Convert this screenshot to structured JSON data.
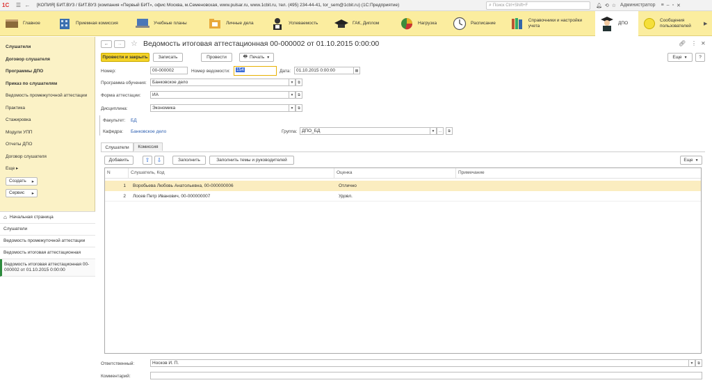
{
  "titlebar": {
    "logo": "1С",
    "title": "[КОПИЯ] БИТ.ВУЗ / БИТ.ВУЗ (компания «Первый БИТ», офис Москва, м.Семеновская, www.pulsar.ru, www.1cbit.ru, тел. (495) 234-44-41, tor_sem@1cbit.ru) (1С:Предприятие)",
    "search_placeholder": "Поиск Ctrl+Shift+F",
    "user": "Администратор"
  },
  "sections": [
    {
      "label": "Главное"
    },
    {
      "label": "Приемная комиссия"
    },
    {
      "label": "Учебные планы"
    },
    {
      "label": "Личные дела"
    },
    {
      "label": "Успеваемость"
    },
    {
      "label": "ГАК, Диплом"
    },
    {
      "label": "Нагрузка"
    },
    {
      "label": "Расписание"
    },
    {
      "label": "Справочники и настройки учета"
    },
    {
      "label": "ДПО"
    },
    {
      "label": "Сообщения пользователей"
    }
  ],
  "nav": {
    "items": [
      "Слушатели",
      "Договор слушателя",
      "Программы ДПО",
      "Приказ по слушателям",
      "Ведомость промежуточной аттестации",
      "Практика",
      "Стажировка",
      "Модули УПП",
      "Отчеты ДПО",
      "Договор слушателя",
      "Еще"
    ],
    "create": "Создать",
    "service": "Сервис"
  },
  "history": {
    "home": "Начальная страница",
    "items": [
      "Слушатели",
      "Ведомость промежуточной аттестации",
      "Ведомость итоговая аттестационная",
      "Ведомость итоговая аттестационная 00-000002 от 01.10.2015 0:00:00"
    ]
  },
  "form": {
    "title": "Ведомость итоговая аттестационная 00-000002 от 01.10.2015 0:00:00",
    "buttons": {
      "post_close": "Провести и закрыть",
      "save": "Записать",
      "post": "Провести",
      "print": "Печать",
      "more": "Еще",
      "help": "?"
    },
    "number_label": "Номер:",
    "number": "00-000002",
    "sheet_label": "Номер ведомости:",
    "sheet": "154",
    "date_label": "Дата:",
    "date": "01.10.2015  0:00:00",
    "program_label": "Программа обучения:",
    "program": "Банковское дело",
    "form_label": "Форма аттестации:",
    "form_value": "ИА",
    "discipline_label": "Дисциплина:",
    "discipline": "Экономика",
    "faculty_label": "Факультет:",
    "faculty": "БД",
    "department_label": "Кафедра:",
    "department": "Банковское дело",
    "group_label": "Группа:",
    "group": "ДПО_БД",
    "tabs": [
      "Слушатели",
      "Комиссия"
    ],
    "table_buttons": {
      "add": "Добавить",
      "fill": "Заполнить",
      "fill_topics": "Заполнить темы и руководителей",
      "more": "Еще"
    },
    "columns": [
      "N",
      "Слушатель, Код",
      "Оценка",
      "Примечание"
    ],
    "rows": [
      {
        "n": "1",
        "student": "Воробьева Любовь Анатольевна, 00-000000006",
        "grade": "Отлично",
        "note": ""
      },
      {
        "n": "2",
        "student": "Лосев Петр Иванович, 00-000000007",
        "grade": "Удовл.",
        "note": ""
      }
    ],
    "responsible_label": "Ответственный:",
    "responsible": "Носков И. П.",
    "comment_label": "Комментарий:",
    "comment": ""
  }
}
